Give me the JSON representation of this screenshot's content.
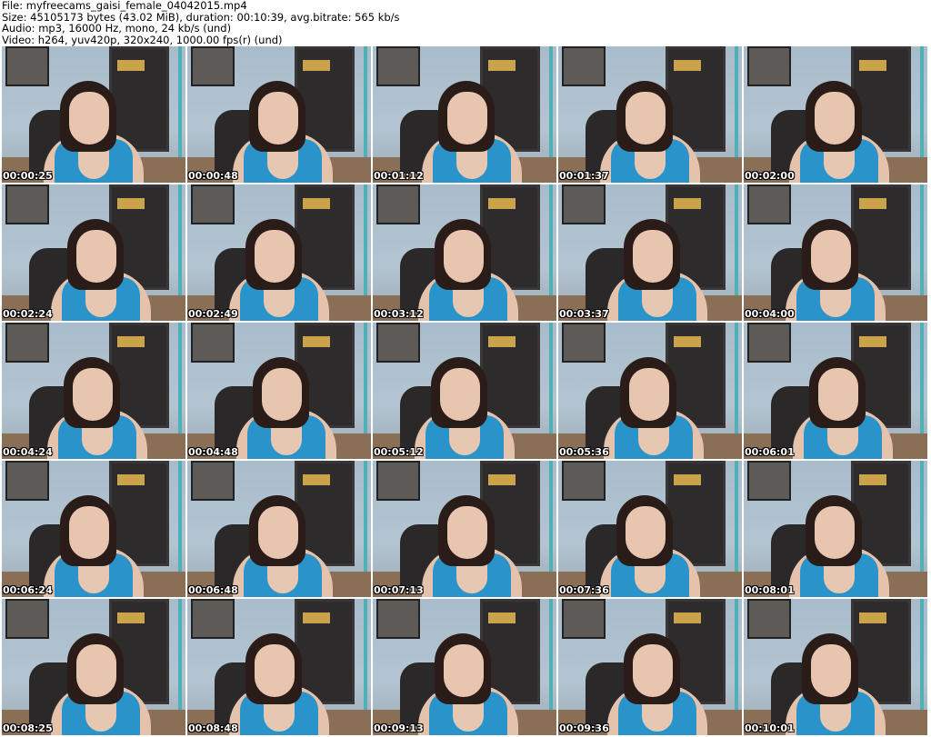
{
  "header": {
    "file": "File: myfreecams_gaisi_female_04042015.mp4",
    "size": "Size: 45105173 bytes (43.02 MiB), duration: 00:10:39, avg.bitrate: 565 kb/s",
    "audio": "Audio: mp3, 16000 Hz, mono, 24 kb/s (und)",
    "video": "Video: h264, yuv420p, 320x240, 1000.00 fps(r) (und)"
  },
  "thumbnails": [
    "00:00:25",
    "00:00:48",
    "00:01:12",
    "00:01:37",
    "00:02:00",
    "00:02:24",
    "00:02:49",
    "00:03:12",
    "00:03:37",
    "00:04:00",
    "00:04:24",
    "00:04:48",
    "00:05:12",
    "00:05:36",
    "00:06:01",
    "00:06:24",
    "00:06:48",
    "00:07:13",
    "00:07:36",
    "00:08:01",
    "00:08:25",
    "00:08:48",
    "00:09:13",
    "00:09:36",
    "00:10:01"
  ]
}
